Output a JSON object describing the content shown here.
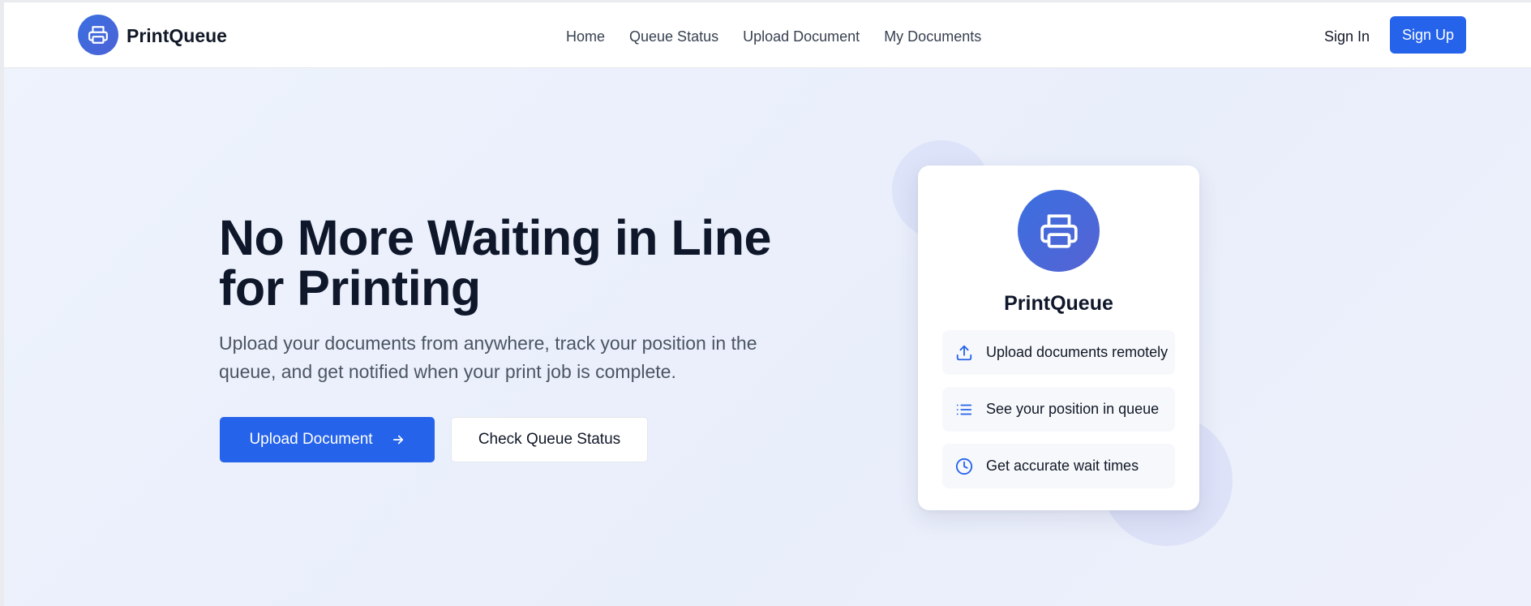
{
  "brand": {
    "name": "PrintQueue",
    "logo_icon": "printer-icon",
    "accent_color": "#2563eb"
  },
  "nav": {
    "items": [
      "Home",
      "Queue Status",
      "Upload Document",
      "My Documents"
    ]
  },
  "auth": {
    "sign_in": "Sign In",
    "sign_up": "Sign Up"
  },
  "hero": {
    "title": "No More Waiting in Line for Printing",
    "subtitle": "Upload your documents from anywhere, track your position in the queue, and get notified when your print job is complete.",
    "primary_button": "Upload Document",
    "primary_button_icon": "arrow-right-icon",
    "secondary_button": "Check Queue Status"
  },
  "card": {
    "title": "PrintQueue",
    "icon": "printer-icon",
    "features": [
      {
        "label": "Upload documents remotely",
        "icon": "upload-icon"
      },
      {
        "label": "See your position in queue",
        "icon": "list-icon"
      },
      {
        "label": "Get accurate wait times",
        "icon": "clock-icon"
      }
    ]
  }
}
